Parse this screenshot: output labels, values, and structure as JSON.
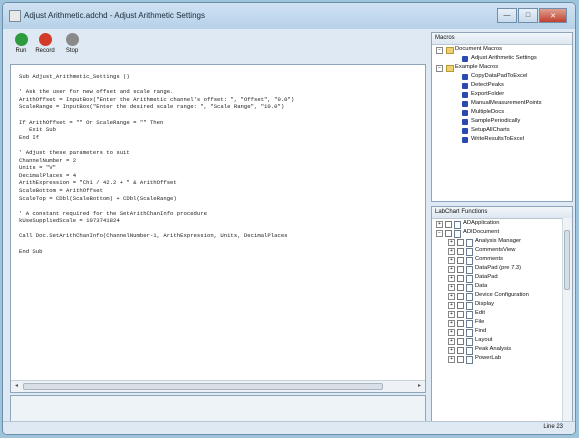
{
  "window": {
    "title": "Adjust Arithmetic.adchd - Adjust Arithmetic Settings",
    "controls": {
      "minimize": "—",
      "maximize": "□",
      "close": "✕"
    }
  },
  "toolbar": {
    "run_label": "Run",
    "record_label": "Record",
    "stop_label": "Stop",
    "run_color": "#2e9b3e",
    "record_color": "#d23a2a",
    "stop_color": "#8a8a8a"
  },
  "editor": {
    "code": [
      "Sub Adjust_Arithmetic_Settings ()",
      "",
      "' Ask the user for new offset and scale range.",
      "ArithOffset = InputBox(\"Enter the Arithmetic channel's offset: \", \"Offset\", \"0.0\")",
      "ScaleRange = InputBox(\"Enter the desired scale range: \", \"Scale Range\", \"10.0\")",
      "",
      "If ArithOffset = \"\" Or ScaleRange = \"\" Then",
      "   Exit Sub",
      "End If",
      "",
      "' Adjust these parameters to suit",
      "ChannelNumber = 2",
      "Units = \"V\"",
      "DecimalPlaces = 4",
      "ArithExpression = \"Ch1 / 42.2 + \" & ArithOffset",
      "ScaleBottom = ArithOffset",
      "ScaleTop = CDbl(ScaleBottom) + CDbl(ScaleRange)",
      "",
      "' A constant required for the SetArithChanInfo procedure",
      "kUseSuppliedScale = 1073741824",
      "",
      "Call Doc.SetArithChanInfo(ChannelNumber-1, ArithExpression, Units, DecimalPlaces",
      "",
      "End Sub"
    ]
  },
  "macros_panel": {
    "title": "Macros",
    "items": [
      {
        "label": "Document Macros",
        "level": 0,
        "kind": "folder",
        "expand": "−"
      },
      {
        "label": "Adjust Arithmetic Settings",
        "level": 1,
        "kind": "macro"
      },
      {
        "label": "Example Macros",
        "level": 0,
        "kind": "folder",
        "expand": "−"
      },
      {
        "label": "CopyDataPadToExcel",
        "level": 1,
        "kind": "macro"
      },
      {
        "label": "DetectPeaks",
        "level": 1,
        "kind": "macro"
      },
      {
        "label": "ExportFolder",
        "level": 1,
        "kind": "macro"
      },
      {
        "label": "ManualMeasurementPoints",
        "level": 1,
        "kind": "macro"
      },
      {
        "label": "MultipleDocs",
        "level": 1,
        "kind": "macro"
      },
      {
        "label": "SamplePeriodically",
        "level": 1,
        "kind": "macro"
      },
      {
        "label": "SetupAllCharts",
        "level": 1,
        "kind": "macro"
      },
      {
        "label": "WriteResultsToExcel",
        "level": 1,
        "kind": "macro"
      }
    ]
  },
  "functions_panel": {
    "title": "LabChart Functions",
    "items": [
      {
        "label": "ADApplication",
        "level": 0,
        "expand": "+"
      },
      {
        "label": "ADIDocument",
        "level": 0,
        "expand": "−"
      },
      {
        "label": "Analysis Manager",
        "level": 1,
        "expand": "+"
      },
      {
        "label": "CommentsView",
        "level": 1,
        "expand": "+"
      },
      {
        "label": "Comments",
        "level": 1,
        "expand": "+"
      },
      {
        "label": "DataPad (pre 7.3)",
        "level": 1,
        "expand": "+"
      },
      {
        "label": "DataPad",
        "level": 1,
        "expand": "+"
      },
      {
        "label": "Data",
        "level": 1,
        "expand": "+"
      },
      {
        "label": "Device Configuration",
        "level": 1,
        "expand": "+"
      },
      {
        "label": "Display",
        "level": 1,
        "expand": "+"
      },
      {
        "label": "Edit",
        "level": 1,
        "expand": "+"
      },
      {
        "label": "File",
        "level": 1,
        "expand": "+"
      },
      {
        "label": "Find",
        "level": 1,
        "expand": "+"
      },
      {
        "label": "Layout",
        "level": 1,
        "expand": "+"
      },
      {
        "label": "Peak Analysis",
        "level": 1,
        "expand": "+"
      },
      {
        "label": "PowerLab",
        "level": 1,
        "expand": "+"
      }
    ]
  },
  "status": {
    "line": "Line 23"
  }
}
